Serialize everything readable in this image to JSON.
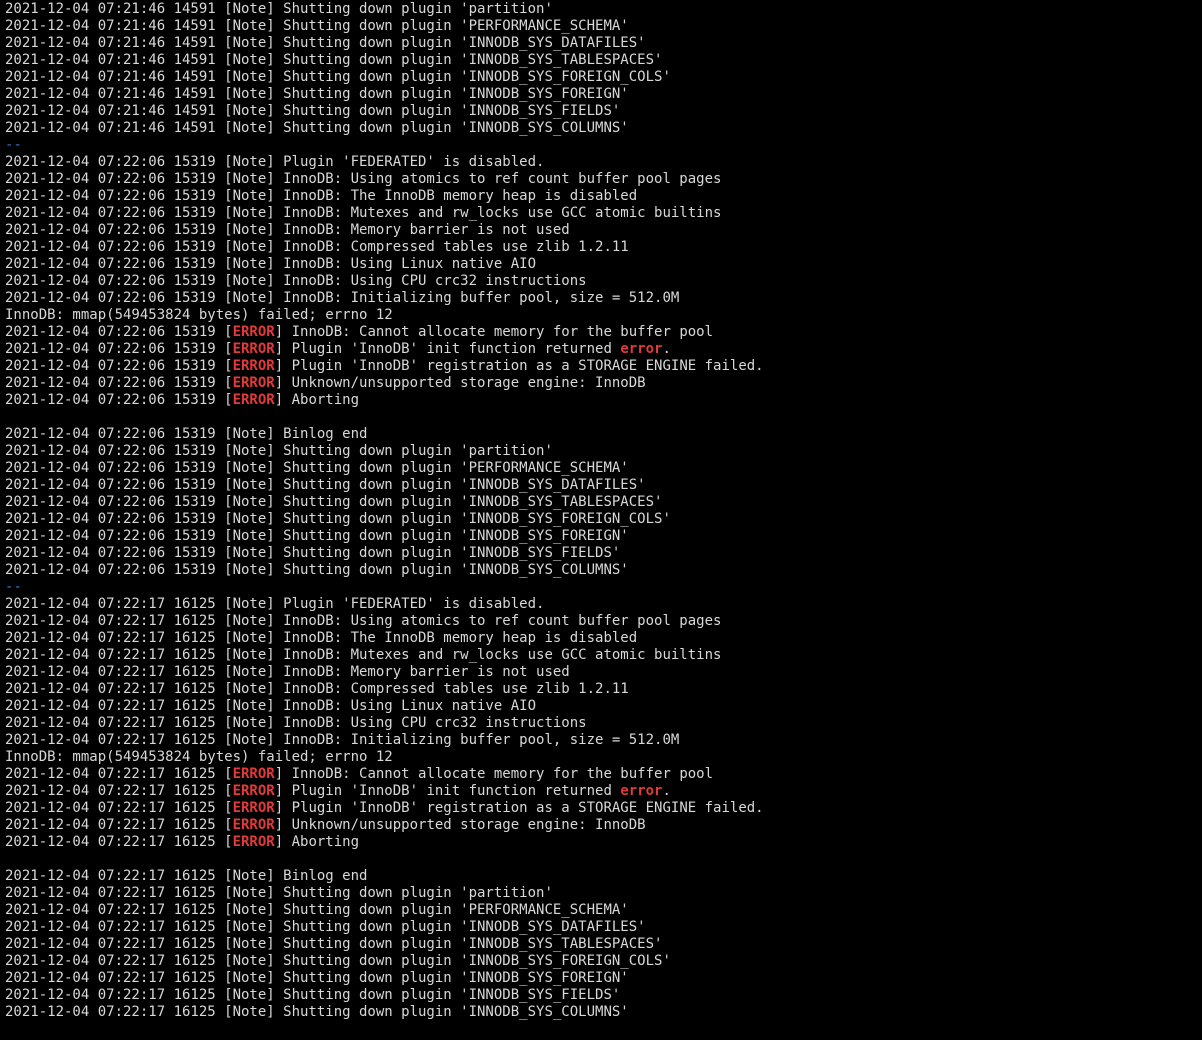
{
  "terminal": {
    "colors": {
      "background": "#000000",
      "text": "#d8d8d8",
      "error": "#e23a3a",
      "separator": "#3b78c8"
    },
    "lines": [
      {
        "segments": [
          {
            "t": "2021-12-04 07:21:46 14591 [Note] Shutting down plugin 'partition'"
          }
        ]
      },
      {
        "segments": [
          {
            "t": "2021-12-04 07:21:46 14591 [Note] Shutting down plugin 'PERFORMANCE_SCHEMA'"
          }
        ]
      },
      {
        "segments": [
          {
            "t": "2021-12-04 07:21:46 14591 [Note] Shutting down plugin 'INNODB_SYS_DATAFILES'"
          }
        ]
      },
      {
        "segments": [
          {
            "t": "2021-12-04 07:21:46 14591 [Note] Shutting down plugin 'INNODB_SYS_TABLESPACES'"
          }
        ]
      },
      {
        "segments": [
          {
            "t": "2021-12-04 07:21:46 14591 [Note] Shutting down plugin 'INNODB_SYS_FOREIGN_COLS'"
          }
        ]
      },
      {
        "segments": [
          {
            "t": "2021-12-04 07:21:46 14591 [Note] Shutting down plugin 'INNODB_SYS_FOREIGN'"
          }
        ]
      },
      {
        "segments": [
          {
            "t": "2021-12-04 07:21:46 14591 [Note] Shutting down plugin 'INNODB_SYS_FIELDS'"
          }
        ]
      },
      {
        "segments": [
          {
            "t": "2021-12-04 07:21:46 14591 [Note] Shutting down plugin 'INNODB_SYS_COLUMNS'"
          }
        ]
      },
      {
        "segments": [
          {
            "t": "--",
            "c": "sep"
          }
        ]
      },
      {
        "segments": [
          {
            "t": "2021-12-04 07:22:06 15319 [Note] Plugin 'FEDERATED' is disabled."
          }
        ]
      },
      {
        "segments": [
          {
            "t": "2021-12-04 07:22:06 15319 [Note] InnoDB: Using atomics to ref count buffer pool pages"
          }
        ]
      },
      {
        "segments": [
          {
            "t": "2021-12-04 07:22:06 15319 [Note] InnoDB: The InnoDB memory heap is disabled"
          }
        ]
      },
      {
        "segments": [
          {
            "t": "2021-12-04 07:22:06 15319 [Note] InnoDB: Mutexes and rw_locks use GCC atomic builtins"
          }
        ]
      },
      {
        "segments": [
          {
            "t": "2021-12-04 07:22:06 15319 [Note] InnoDB: Memory barrier is not used"
          }
        ]
      },
      {
        "segments": [
          {
            "t": "2021-12-04 07:22:06 15319 [Note] InnoDB: Compressed tables use zlib 1.2.11"
          }
        ]
      },
      {
        "segments": [
          {
            "t": "2021-12-04 07:22:06 15319 [Note] InnoDB: Using Linux native AIO"
          }
        ]
      },
      {
        "segments": [
          {
            "t": "2021-12-04 07:22:06 15319 [Note] InnoDB: Using CPU crc32 instructions"
          }
        ]
      },
      {
        "segments": [
          {
            "t": "2021-12-04 07:22:06 15319 [Note] InnoDB: Initializing buffer pool, size = 512.0M"
          }
        ]
      },
      {
        "segments": [
          {
            "t": "InnoDB: mmap(549453824 bytes) failed; errno 12"
          }
        ]
      },
      {
        "segments": [
          {
            "t": "2021-12-04 07:22:06 15319 ["
          },
          {
            "t": "ERROR",
            "c": "err"
          },
          {
            "t": "] InnoDB: Cannot allocate memory for the buffer pool"
          }
        ]
      },
      {
        "segments": [
          {
            "t": "2021-12-04 07:22:06 15319 ["
          },
          {
            "t": "ERROR",
            "c": "err"
          },
          {
            "t": "] Plugin 'InnoDB' init function returned "
          },
          {
            "t": "error",
            "c": "err"
          },
          {
            "t": "."
          }
        ]
      },
      {
        "segments": [
          {
            "t": "2021-12-04 07:22:06 15319 ["
          },
          {
            "t": "ERROR",
            "c": "err"
          },
          {
            "t": "] Plugin 'InnoDB' registration as a STORAGE ENGINE failed."
          }
        ]
      },
      {
        "segments": [
          {
            "t": "2021-12-04 07:22:06 15319 ["
          },
          {
            "t": "ERROR",
            "c": "err"
          },
          {
            "t": "] Unknown/unsupported storage engine: InnoDB"
          }
        ]
      },
      {
        "segments": [
          {
            "t": "2021-12-04 07:22:06 15319 ["
          },
          {
            "t": "ERROR",
            "c": "err"
          },
          {
            "t": "] Aborting"
          }
        ]
      },
      {
        "segments": [
          {
            "t": ""
          }
        ]
      },
      {
        "segments": [
          {
            "t": "2021-12-04 07:22:06 15319 [Note] Binlog end"
          }
        ]
      },
      {
        "segments": [
          {
            "t": "2021-12-04 07:22:06 15319 [Note] Shutting down plugin 'partition'"
          }
        ]
      },
      {
        "segments": [
          {
            "t": "2021-12-04 07:22:06 15319 [Note] Shutting down plugin 'PERFORMANCE_SCHEMA'"
          }
        ]
      },
      {
        "segments": [
          {
            "t": "2021-12-04 07:22:06 15319 [Note] Shutting down plugin 'INNODB_SYS_DATAFILES'"
          }
        ]
      },
      {
        "segments": [
          {
            "t": "2021-12-04 07:22:06 15319 [Note] Shutting down plugin 'INNODB_SYS_TABLESPACES'"
          }
        ]
      },
      {
        "segments": [
          {
            "t": "2021-12-04 07:22:06 15319 [Note] Shutting down plugin 'INNODB_SYS_FOREIGN_COLS'"
          }
        ]
      },
      {
        "segments": [
          {
            "t": "2021-12-04 07:22:06 15319 [Note] Shutting down plugin 'INNODB_SYS_FOREIGN'"
          }
        ]
      },
      {
        "segments": [
          {
            "t": "2021-12-04 07:22:06 15319 [Note] Shutting down plugin 'INNODB_SYS_FIELDS'"
          }
        ]
      },
      {
        "segments": [
          {
            "t": "2021-12-04 07:22:06 15319 [Note] Shutting down plugin 'INNODB_SYS_COLUMNS'"
          }
        ]
      },
      {
        "segments": [
          {
            "t": "--",
            "c": "sep"
          }
        ]
      },
      {
        "segments": [
          {
            "t": "2021-12-04 07:22:17 16125 [Note] Plugin 'FEDERATED' is disabled."
          }
        ]
      },
      {
        "segments": [
          {
            "t": "2021-12-04 07:22:17 16125 [Note] InnoDB: Using atomics to ref count buffer pool pages"
          }
        ]
      },
      {
        "segments": [
          {
            "t": "2021-12-04 07:22:17 16125 [Note] InnoDB: The InnoDB memory heap is disabled"
          }
        ]
      },
      {
        "segments": [
          {
            "t": "2021-12-04 07:22:17 16125 [Note] InnoDB: Mutexes and rw_locks use GCC atomic builtins"
          }
        ]
      },
      {
        "segments": [
          {
            "t": "2021-12-04 07:22:17 16125 [Note] InnoDB: Memory barrier is not used"
          }
        ]
      },
      {
        "segments": [
          {
            "t": "2021-12-04 07:22:17 16125 [Note] InnoDB: Compressed tables use zlib 1.2.11"
          }
        ]
      },
      {
        "segments": [
          {
            "t": "2021-12-04 07:22:17 16125 [Note] InnoDB: Using Linux native AIO"
          }
        ]
      },
      {
        "segments": [
          {
            "t": "2021-12-04 07:22:17 16125 [Note] InnoDB: Using CPU crc32 instructions"
          }
        ]
      },
      {
        "segments": [
          {
            "t": "2021-12-04 07:22:17 16125 [Note] InnoDB: Initializing buffer pool, size = 512.0M"
          }
        ]
      },
      {
        "segments": [
          {
            "t": "InnoDB: mmap(549453824 bytes) failed; errno 12"
          }
        ]
      },
      {
        "segments": [
          {
            "t": "2021-12-04 07:22:17 16125 ["
          },
          {
            "t": "ERROR",
            "c": "err"
          },
          {
            "t": "] InnoDB: Cannot allocate memory for the buffer pool"
          }
        ]
      },
      {
        "segments": [
          {
            "t": "2021-12-04 07:22:17 16125 ["
          },
          {
            "t": "ERROR",
            "c": "err"
          },
          {
            "t": "] Plugin 'InnoDB' init function returned "
          },
          {
            "t": "error",
            "c": "err"
          },
          {
            "t": "."
          }
        ]
      },
      {
        "segments": [
          {
            "t": "2021-12-04 07:22:17 16125 ["
          },
          {
            "t": "ERROR",
            "c": "err"
          },
          {
            "t": "] Plugin 'InnoDB' registration as a STORAGE ENGINE failed."
          }
        ]
      },
      {
        "segments": [
          {
            "t": "2021-12-04 07:22:17 16125 ["
          },
          {
            "t": "ERROR",
            "c": "err"
          },
          {
            "t": "] Unknown/unsupported storage engine: InnoDB"
          }
        ]
      },
      {
        "segments": [
          {
            "t": "2021-12-04 07:22:17 16125 ["
          },
          {
            "t": "ERROR",
            "c": "err"
          },
          {
            "t": "] Aborting"
          }
        ]
      },
      {
        "segments": [
          {
            "t": ""
          }
        ]
      },
      {
        "segments": [
          {
            "t": "2021-12-04 07:22:17 16125 [Note] Binlog end"
          }
        ]
      },
      {
        "segments": [
          {
            "t": "2021-12-04 07:22:17 16125 [Note] Shutting down plugin 'partition'"
          }
        ]
      },
      {
        "segments": [
          {
            "t": "2021-12-04 07:22:17 16125 [Note] Shutting down plugin 'PERFORMANCE_SCHEMA'"
          }
        ]
      },
      {
        "segments": [
          {
            "t": "2021-12-04 07:22:17 16125 [Note] Shutting down plugin 'INNODB_SYS_DATAFILES'"
          }
        ]
      },
      {
        "segments": [
          {
            "t": "2021-12-04 07:22:17 16125 [Note] Shutting down plugin 'INNODB_SYS_TABLESPACES'"
          }
        ]
      },
      {
        "segments": [
          {
            "t": "2021-12-04 07:22:17 16125 [Note] Shutting down plugin 'INNODB_SYS_FOREIGN_COLS'"
          }
        ]
      },
      {
        "segments": [
          {
            "t": "2021-12-04 07:22:17 16125 [Note] Shutting down plugin 'INNODB_SYS_FOREIGN'"
          }
        ]
      },
      {
        "segments": [
          {
            "t": "2021-12-04 07:22:17 16125 [Note] Shutting down plugin 'INNODB_SYS_FIELDS'"
          }
        ]
      },
      {
        "segments": [
          {
            "t": "2021-12-04 07:22:17 16125 [Note] Shutting down plugin 'INNODB_SYS_COLUMNS'"
          }
        ]
      }
    ]
  }
}
